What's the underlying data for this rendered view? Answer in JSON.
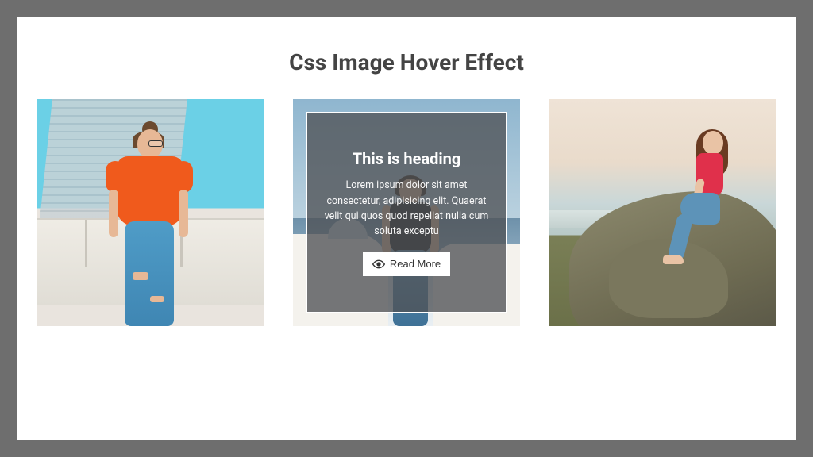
{
  "title": "Css Image Hover Effect",
  "overlay": {
    "heading": "This is heading",
    "body": "Lorem ipsum dolor sit amet consectetur, adipisicing elit. Quaerat velit qui quos quod repellat nulla cum soluta exceptu",
    "button_label": "Read More"
  }
}
